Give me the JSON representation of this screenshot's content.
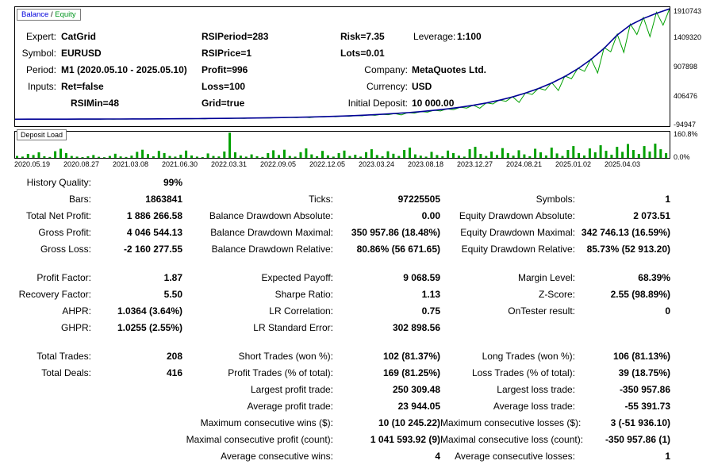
{
  "info": {
    "rows": [
      {
        "label": "Expert:",
        "value": "CatGrid",
        "param": "RSIPeriod=283",
        "param2": "Risk=7.35",
        "leverage_label": "Leverage:",
        "leverage_value": "1:100"
      },
      {
        "label": "Symbol:",
        "value": "EURUSD",
        "param": "RSIPrice=1",
        "param2": "Lots=0.01"
      },
      {
        "label": "Period:",
        "value": "M1 (2020.05.10 - 2025.05.10)",
        "param": "Profit=996",
        "right_label": "Company:",
        "right_value": "MetaQuotes Ltd."
      },
      {
        "label": "Inputs:",
        "value": "Ret=false",
        "param": "Loss=100",
        "right_label": "Currency:",
        "right_value": "USD"
      },
      {
        "label": "",
        "value": "RSIMin=48",
        "param": "Grid=true",
        "right_label": "Initial Deposit:",
        "right_value": "10 000.00"
      }
    ]
  },
  "chart_data": [
    {
      "type": "line",
      "title": "Balance / Equity",
      "legend": {
        "balance": "Balance",
        "separator": " / ",
        "equity": "Equity"
      },
      "ylim": [
        -94947,
        1910743
      ],
      "y_ticks": [
        1910743,
        1409320,
        907898,
        406476,
        -94947
      ],
      "grid": false,
      "legend_position": "top-left",
      "series": [
        {
          "name": "Balance",
          "color": "#000096",
          "values": [
            10000,
            10200,
            10500,
            10800,
            11200,
            11700,
            12200,
            12800,
            13500,
            14300,
            15200,
            16300,
            17500,
            18900,
            20500,
            22300,
            24400,
            26800,
            29500,
            32600,
            36200,
            40300,
            45000,
            50500,
            56800,
            64000,
            72400,
            82100,
            93400,
            106500,
            121800,
            139700,
            160600,
            185100,
            213900,
            247800,
            287700,
            334900,
            390700,
            456900,
            535500,
            629000,
            740300,
            873000,
            1031500,
            1221000,
            1448000,
            1620000,
            1730000,
            1820000,
            1896266
          ]
        },
        {
          "name": "Equity",
          "color": "#00a000",
          "values": [
            10100,
            8800,
            10300,
            9000,
            10600,
            9300,
            10900,
            9600,
            11300,
            10000,
            11800,
            10400,
            12300,
            10900,
            12900,
            11400,
            13600,
            12100,
            14400,
            12800,
            15400,
            13700,
            16500,
            14700,
            17700,
            15800,
            19100,
            17100,
            20700,
            15800,
            22500,
            20300,
            24600,
            22300,
            27100,
            24500,
            29800,
            27000,
            32900,
            29900,
            36600,
            33300,
            40700,
            37100,
            45500,
            36300,
            51000,
            46700,
            57400,
            52500,
            64600,
            59300,
            73100,
            67200,
            82900,
            76300,
            94300,
            87000,
            107600,
            82200,
            123000,
            113800,
            141100,
            130600,
            162200,
            150400,
            187000,
            173600,
            216000,
            200800,
            250300,
            198100,
            290600,
            270800,
            338200,
            315600,
            394600,
            296700,
            461500,
            431700,
            540900,
            506600,
            635300,
            499800,
            747700,
            701800,
            881700,
            828500,
            1041800,
            799600,
            1233200,
            1161000,
            1462500,
            1150500,
            1636200,
            1457300,
            1747300,
            1420000,
            1838200,
            1616500,
            1896266
          ]
        }
      ]
    },
    {
      "type": "bar",
      "title": "Deposit Load",
      "ylim": [
        0,
        160.8
      ],
      "y_ticks": [
        "160.8%",
        "0.0%"
      ],
      "color": "#00a000",
      "values": [
        12,
        8,
        25,
        18,
        35,
        10,
        6,
        42,
        58,
        30,
        12,
        8,
        5,
        10,
        18,
        7,
        4,
        12,
        26,
        9,
        6,
        14,
        38,
        52,
        24,
        10,
        44,
        30,
        12,
        8,
        20,
        46,
        15,
        8,
        5,
        28,
        12,
        9,
        40,
        160,
        35,
        14,
        8,
        22,
        10,
        6,
        30,
        48,
        18,
        52,
        12,
        8,
        36,
        60,
        22,
        10,
        44,
        16,
        8,
        30,
        46,
        12,
        20,
        8,
        36,
        55,
        18,
        10,
        42,
        26,
        12,
        50,
        65,
        22,
        14,
        8,
        38,
        18,
        10,
        46,
        30,
        14,
        8,
        55,
        70,
        25,
        12,
        40,
        18,
        62,
        30,
        14,
        48,
        22,
        10,
        58,
        35,
        15,
        65,
        28,
        12,
        50,
        75,
        30,
        15,
        60,
        35,
        80,
        45,
        20,
        70,
        38,
        88,
        50,
        25,
        75,
        40,
        90,
        55,
        30
      ],
      "x_labels": [
        "2020.05.19",
        "2020.08.27",
        "2021.03.08",
        "2021.06.30",
        "2022.03.31",
        "2022.09.05",
        "2022.12.05",
        "2023.03.24",
        "2023.08.18",
        "2023.12.27",
        "2024.08.21",
        "2025.01.02",
        "2025.04.03"
      ]
    }
  ],
  "stats": {
    "rows": [
      [
        {
          "l": "History Quality:",
          "v": "99%"
        },
        null,
        null
      ],
      [
        {
          "l": "Bars:",
          "v": "1863841"
        },
        {
          "l": "Ticks:",
          "v": "97225505"
        },
        {
          "l": "Symbols:",
          "v": "1"
        }
      ],
      [
        {
          "l": "Total Net Profit:",
          "v": "1 886 266.58"
        },
        {
          "l": "Balance Drawdown Absolute:",
          "v": "0.00"
        },
        {
          "l": "Equity Drawdown Absolute:",
          "v": "2 073.51"
        }
      ],
      [
        {
          "l": "Gross Profit:",
          "v": "4 046 544.13"
        },
        {
          "l": "Balance Drawdown Maximal:",
          "v": "350 957.86 (18.48%)"
        },
        {
          "l": "Equity Drawdown Maximal:",
          "v": "342 746.13 (16.59%)"
        }
      ],
      [
        {
          "l": "Gross Loss:",
          "v": "-2 160 277.55"
        },
        {
          "l": "Balance Drawdown Relative:",
          "v": "80.86% (56 671.65)"
        },
        {
          "l": "Equity Drawdown Relative:",
          "v": "85.73% (52 913.20)"
        }
      ],
      "spacer",
      [
        {
          "l": "Profit Factor:",
          "v": "1.87"
        },
        {
          "l": "Expected Payoff:",
          "v": "9 068.59"
        },
        {
          "l": "Margin Level:",
          "v": "68.39%"
        }
      ],
      [
        {
          "l": "Recovery Factor:",
          "v": "5.50"
        },
        {
          "l": "Sharpe Ratio:",
          "v": "1.13"
        },
        {
          "l": "Z-Score:",
          "v": "2.55 (98.89%)"
        }
      ],
      [
        {
          "l": "AHPR:",
          "v": "1.0364 (3.64%)"
        },
        {
          "l": "LR Correlation:",
          "v": "0.75"
        },
        {
          "l": "OnTester result:",
          "v": "0"
        }
      ],
      [
        {
          "l": "GHPR:",
          "v": "1.0255 (2.55%)"
        },
        {
          "l": "LR Standard Error:",
          "v": "302 898.56"
        },
        null
      ],
      "spacer",
      [
        {
          "l": "Total Trades:",
          "v": "208"
        },
        {
          "l": "Short Trades (won %):",
          "v": "102 (81.37%)"
        },
        {
          "l": "Long Trades (won %):",
          "v": "106 (81.13%)"
        }
      ],
      [
        {
          "l": "Total Deals:",
          "v": "416"
        },
        {
          "l": "Profit Trades (% of total):",
          "v": "169 (81.25%)"
        },
        {
          "l": "Loss Trades (% of total):",
          "v": "39 (18.75%)"
        }
      ],
      [
        null,
        {
          "l": "Largest profit trade:",
          "v": "250 309.48"
        },
        {
          "l": "Largest loss trade:",
          "v": "-350 957.86"
        }
      ],
      [
        null,
        {
          "l": "Average profit trade:",
          "v": "23 944.05"
        },
        {
          "l": "Average loss trade:",
          "v": "-55 391.73"
        }
      ],
      [
        null,
        {
          "l": "Maximum consecutive wins ($):",
          "v": "10 (10 245.22)"
        },
        {
          "l": "Maximum consecutive losses ($):",
          "v": "3 (-51 936.10)"
        }
      ],
      [
        null,
        {
          "l": "Maximal consecutive profit (count):",
          "v": "1 041 593.92 (9)"
        },
        {
          "l": "Maximal consecutive loss (count):",
          "v": "-350 957.86 (1)"
        }
      ],
      [
        null,
        {
          "l": "Average consecutive wins:",
          "v": "4"
        },
        {
          "l": "Average consecutive losses:",
          "v": "1"
        }
      ]
    ]
  }
}
